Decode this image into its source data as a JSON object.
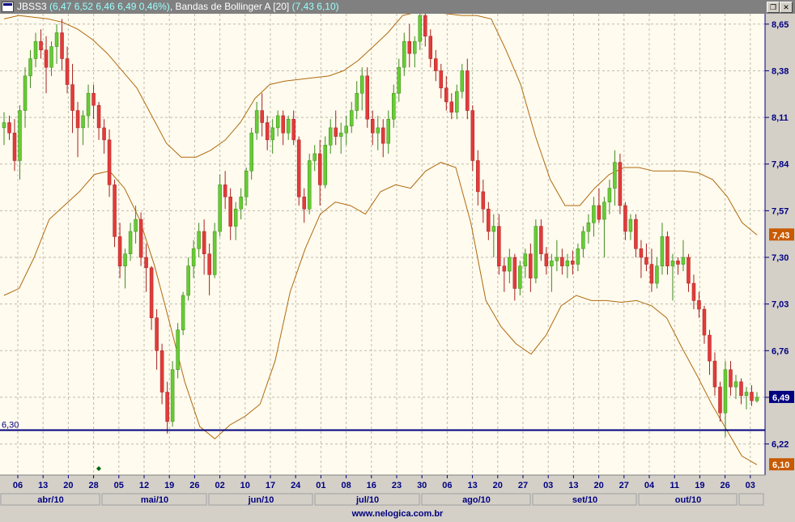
{
  "window": {
    "ticker": "JBSS3",
    "quote": "(6,47  6,52  6,46  6,49  0,46%)",
    "indicator": ", Bandas de Bollinger A [20]",
    "bands_value": "(7,43  6,10)",
    "footer": "www.nelogica.com.br"
  },
  "colors": {
    "background": "#fffbee",
    "up_candle": "#66cc33",
    "down_candle": "#e23b3b",
    "bands": "#b06a10",
    "support_line": "#000080",
    "last_price_badge": "#000080",
    "band_badge": "#c85a00"
  },
  "chart_data": {
    "type": "candlestick",
    "title": "JBSS3",
    "indicator": "Bandas de Bollinger A [20]",
    "y_ticks": [
      "6,22",
      "6,49",
      "6,76",
      "7,03",
      "7,30",
      "7,57",
      "7,84",
      "8,11",
      "8,38",
      "8,65"
    ],
    "ylim": [
      6.1,
      8.7
    ],
    "x_tick_labels": [
      "06",
      "13",
      "20",
      "28",
      "05",
      "12",
      "19",
      "26",
      "02",
      "10",
      "17",
      "24",
      "01",
      "08",
      "16",
      "23",
      "30",
      "06",
      "13",
      "20",
      "27",
      "03",
      "13",
      "20",
      "27",
      "04",
      "11",
      "19",
      "26",
      "03"
    ],
    "month_labels": [
      "abr/10",
      "mai/10",
      "jun/10",
      "jul/10",
      "ago/10",
      "set/10",
      "out/10"
    ],
    "price_badges": {
      "last": "6,49",
      "upper_band": "7,43",
      "lower_band": "6,10"
    },
    "support_line": {
      "value": 6.3,
      "label": "6,30"
    },
    "candles": [
      [
        8.05,
        8.14,
        7.95,
        8.08
      ],
      [
        8.08,
        8.12,
        7.98,
        8.02
      ],
      [
        8.02,
        8.1,
        7.8,
        7.86
      ],
      [
        7.86,
        8.18,
        7.75,
        8.15
      ],
      [
        8.15,
        8.4,
        8.05,
        8.35
      ],
      [
        8.35,
        8.5,
        8.28,
        8.45
      ],
      [
        8.45,
        8.6,
        8.4,
        8.55
      ],
      [
        8.55,
        8.62,
        8.45,
        8.5
      ],
      [
        8.5,
        8.58,
        8.25,
        8.4
      ],
      [
        8.4,
        8.55,
        8.35,
        8.52
      ],
      [
        8.52,
        8.65,
        8.42,
        8.6
      ],
      [
        8.6,
        8.68,
        8.38,
        8.45
      ],
      [
        8.45,
        8.52,
        8.25,
        8.3
      ],
      [
        8.3,
        8.42,
        8.02,
        8.15
      ],
      [
        8.15,
        8.2,
        7.88,
        8.05
      ],
      [
        8.05,
        8.15,
        7.95,
        8.12
      ],
      [
        8.12,
        8.3,
        8.05,
        8.25
      ],
      [
        8.25,
        8.3,
        8.1,
        8.18
      ],
      [
        8.18,
        8.2,
        7.98,
        8.05
      ],
      [
        8.05,
        8.1,
        7.9,
        7.98
      ],
      [
        7.98,
        8.04,
        7.65,
        7.72
      ],
      [
        7.72,
        7.75,
        7.36,
        7.42
      ],
      [
        7.42,
        7.5,
        7.18,
        7.25
      ],
      [
        7.25,
        7.35,
        7.12,
        7.32
      ],
      [
        7.32,
        7.5,
        7.28,
        7.45
      ],
      [
        7.45,
        7.6,
        7.38,
        7.52
      ],
      [
        7.52,
        7.56,
        7.25,
        7.3
      ],
      [
        7.3,
        7.38,
        7.1,
        7.24
      ],
      [
        7.24,
        7.25,
        6.88,
        6.95
      ],
      [
        6.95,
        7.0,
        6.65,
        6.76
      ],
      [
        6.76,
        6.8,
        6.45,
        6.52
      ],
      [
        6.52,
        6.58,
        6.28,
        6.35
      ],
      [
        6.35,
        6.7,
        6.32,
        6.65
      ],
      [
        6.65,
        6.92,
        6.6,
        6.88
      ],
      [
        6.88,
        7.1,
        6.85,
        7.08
      ],
      [
        7.08,
        7.3,
        7.05,
        7.25
      ],
      [
        7.25,
        7.4,
        7.18,
        7.35
      ],
      [
        7.35,
        7.5,
        7.3,
        7.45
      ],
      [
        7.45,
        7.52,
        7.2,
        7.32
      ],
      [
        7.32,
        7.38,
        7.08,
        7.2
      ],
      [
        7.2,
        7.5,
        7.18,
        7.45
      ],
      [
        7.45,
        7.78,
        7.42,
        7.72
      ],
      [
        7.72,
        7.8,
        7.58,
        7.65
      ],
      [
        7.65,
        7.7,
        7.4,
        7.48
      ],
      [
        7.48,
        7.62,
        7.4,
        7.58
      ],
      [
        7.58,
        7.7,
        7.52,
        7.65
      ],
      [
        7.65,
        7.82,
        7.6,
        7.8
      ],
      [
        7.8,
        8.05,
        7.75,
        8.02
      ],
      [
        8.02,
        8.2,
        7.98,
        8.15
      ],
      [
        8.15,
        8.25,
        8.0,
        8.08
      ],
      [
        8.08,
        8.12,
        7.92,
        7.98
      ],
      [
        7.98,
        8.1,
        7.9,
        8.05
      ],
      [
        8.05,
        8.15,
        8.0,
        8.12
      ],
      [
        8.12,
        8.15,
        7.95,
        8.02
      ],
      [
        8.02,
        8.12,
        7.98,
        8.1
      ],
      [
        8.1,
        8.15,
        7.95,
        7.98
      ],
      [
        7.98,
        8.0,
        7.6,
        7.65
      ],
      [
        7.65,
        7.7,
        7.5,
        7.58
      ],
      [
        7.58,
        7.9,
        7.55,
        7.86
      ],
      [
        7.86,
        7.95,
        7.8,
        7.9
      ],
      [
        7.9,
        7.98,
        7.6,
        7.72
      ],
      [
        7.72,
        8.0,
        7.7,
        7.95
      ],
      [
        7.95,
        8.1,
        7.9,
        8.05
      ],
      [
        8.05,
        8.15,
        7.95,
        8.0
      ],
      [
        8.0,
        8.08,
        7.9,
        8.02
      ],
      [
        8.02,
        8.12,
        7.95,
        8.06
      ],
      [
        8.06,
        8.2,
        8.02,
        8.15
      ],
      [
        8.15,
        8.32,
        8.1,
        8.25
      ],
      [
        8.25,
        8.4,
        8.15,
        8.35
      ],
      [
        8.35,
        8.4,
        8.05,
        8.1
      ],
      [
        8.1,
        8.15,
        7.95,
        8.02
      ],
      [
        8.02,
        8.12,
        7.92,
        8.05
      ],
      [
        8.05,
        8.1,
        7.88,
        7.96
      ],
      [
        7.96,
        8.15,
        7.9,
        8.1
      ],
      [
        8.1,
        8.3,
        8.05,
        8.25
      ],
      [
        8.25,
        8.45,
        8.2,
        8.4
      ],
      [
        8.4,
        8.6,
        8.35,
        8.55
      ],
      [
        8.55,
        8.65,
        8.4,
        8.48
      ],
      [
        8.48,
        8.58,
        8.4,
        8.55
      ],
      [
        8.55,
        8.75,
        8.5,
        8.7
      ],
      [
        8.7,
        8.72,
        8.52,
        8.58
      ],
      [
        8.58,
        8.62,
        8.4,
        8.45
      ],
      [
        8.45,
        8.5,
        8.32,
        8.38
      ],
      [
        8.38,
        8.42,
        8.22,
        8.28
      ],
      [
        8.28,
        8.35,
        8.15,
        8.2
      ],
      [
        8.2,
        8.25,
        8.1,
        8.14
      ],
      [
        8.14,
        8.3,
        8.1,
        8.26
      ],
      [
        8.26,
        8.42,
        8.22,
        8.38
      ],
      [
        8.38,
        8.45,
        8.1,
        8.15
      ],
      [
        8.15,
        8.18,
        7.8,
        7.86
      ],
      [
        7.86,
        7.92,
        7.6,
        7.68
      ],
      [
        7.68,
        7.75,
        7.5,
        7.58
      ],
      [
        7.58,
        7.62,
        7.4,
        7.45
      ],
      [
        7.45,
        7.55,
        7.3,
        7.48
      ],
      [
        7.48,
        7.55,
        7.2,
        7.25
      ],
      [
        7.25,
        7.3,
        7.1,
        7.22
      ],
      [
        7.22,
        7.35,
        7.15,
        7.3
      ],
      [
        7.3,
        7.32,
        7.05,
        7.12
      ],
      [
        7.12,
        7.28,
        7.08,
        7.25
      ],
      [
        7.25,
        7.35,
        7.18,
        7.32
      ],
      [
        7.32,
        7.38,
        7.1,
        7.18
      ],
      [
        7.18,
        7.52,
        7.15,
        7.48
      ],
      [
        7.48,
        7.52,
        7.28,
        7.32
      ],
      [
        7.32,
        7.36,
        7.2,
        7.25
      ],
      [
        7.25,
        7.32,
        7.1,
        7.28
      ],
      [
        7.28,
        7.4,
        7.22,
        7.3
      ],
      [
        7.3,
        7.35,
        7.2,
        7.25
      ],
      [
        7.25,
        7.32,
        7.18,
        7.28
      ],
      [
        7.28,
        7.34,
        7.2,
        7.26
      ],
      [
        7.26,
        7.38,
        7.22,
        7.35
      ],
      [
        7.35,
        7.48,
        7.3,
        7.45
      ],
      [
        7.45,
        7.55,
        7.38,
        7.5
      ],
      [
        7.5,
        7.65,
        7.42,
        7.6
      ],
      [
        7.6,
        7.7,
        7.5,
        7.52
      ],
      [
        7.52,
        7.65,
        7.3,
        7.62
      ],
      [
        7.62,
        7.75,
        7.55,
        7.7
      ],
      [
        7.7,
        7.92,
        7.6,
        7.85
      ],
      [
        7.85,
        7.9,
        7.55,
        7.6
      ],
      [
        7.6,
        7.62,
        7.4,
        7.45
      ],
      [
        7.45,
        7.55,
        7.4,
        7.52
      ],
      [
        7.52,
        7.55,
        7.3,
        7.35
      ],
      [
        7.35,
        7.4,
        7.18,
        7.3
      ],
      [
        7.3,
        7.38,
        7.22,
        7.26
      ],
      [
        7.26,
        7.35,
        7.1,
        7.15
      ],
      [
        7.15,
        7.3,
        7.12,
        7.25
      ],
      [
        7.25,
        7.5,
        7.2,
        7.42
      ],
      [
        7.42,
        7.45,
        7.2,
        7.25
      ],
      [
        7.25,
        7.32,
        7.05,
        7.28
      ],
      [
        7.28,
        7.3,
        7.2,
        7.26
      ],
      [
        7.26,
        7.4,
        7.22,
        7.3
      ],
      [
        7.3,
        7.32,
        7.1,
        7.15
      ],
      [
        7.15,
        7.2,
        7.0,
        7.05
      ],
      [
        7.05,
        7.1,
        6.95,
        7.0
      ],
      [
        7.0,
        7.02,
        6.8,
        6.85
      ],
      [
        6.85,
        6.88,
        6.62,
        6.7
      ],
      [
        6.7,
        6.75,
        6.5,
        6.55
      ],
      [
        6.55,
        6.58,
        6.35,
        6.4
      ],
      [
        6.4,
        6.7,
        6.26,
        6.65
      ],
      [
        6.65,
        6.7,
        6.5,
        6.55
      ],
      [
        6.55,
        6.62,
        6.48,
        6.58
      ],
      [
        6.58,
        6.6,
        6.45,
        6.5
      ],
      [
        6.5,
        6.55,
        6.42,
        6.52
      ],
      [
        6.52,
        6.56,
        6.44,
        6.47
      ],
      [
        6.47,
        6.52,
        6.46,
        6.49
      ]
    ],
    "upper_band": [
      8.68,
      8.7,
      8.69,
      8.68,
      8.66,
      8.62,
      8.56,
      8.48,
      8.38,
      8.28,
      8.12,
      7.96,
      7.88,
      7.88,
      7.92,
      7.98,
      8.08,
      8.22,
      8.3,
      8.32,
      8.33,
      8.34,
      8.35,
      8.38,
      8.44,
      8.52,
      8.6,
      8.7,
      8.72,
      8.72,
      8.71,
      8.7,
      8.7,
      8.68,
      8.5,
      8.3,
      8.0,
      7.75,
      7.6,
      7.6,
      7.7,
      7.78,
      7.82,
      7.82,
      7.8,
      7.8,
      7.8,
      7.79,
      7.75,
      7.65,
      7.5,
      7.43
    ],
    "lower_band": [
      7.08,
      7.12,
      7.3,
      7.52,
      7.6,
      7.68,
      7.78,
      7.8,
      7.7,
      7.52,
      7.25,
      6.92,
      6.58,
      6.32,
      6.25,
      6.33,
      6.38,
      6.45,
      6.7,
      7.1,
      7.35,
      7.55,
      7.62,
      7.6,
      7.55,
      7.68,
      7.72,
      7.7,
      7.8,
      7.85,
      7.82,
      7.5,
      7.05,
      6.9,
      6.8,
      6.74,
      6.85,
      7.02,
      7.08,
      7.05,
      7.05,
      7.04,
      7.05,
      7.02,
      6.95,
      6.78,
      6.62,
      6.45,
      6.3,
      6.15,
      6.1
    ]
  }
}
